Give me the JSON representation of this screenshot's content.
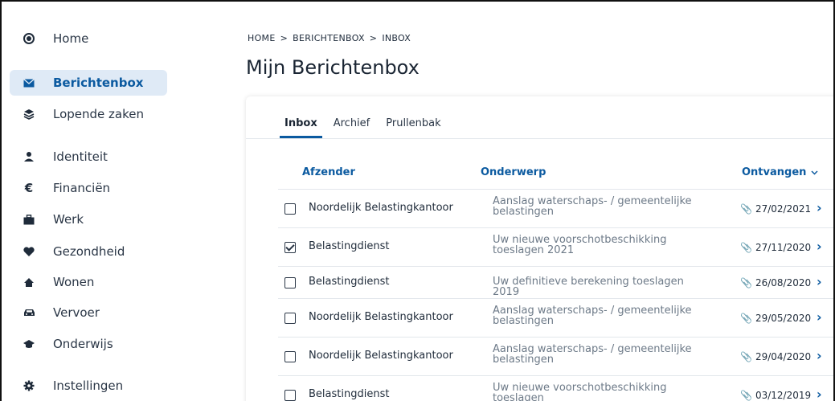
{
  "sidebar": {
    "items": [
      {
        "label": "Home",
        "icon": "home-icon"
      },
      {
        "label": "Berichtenbox",
        "icon": "envelope-icon",
        "active": true
      },
      {
        "label": "Lopende zaken",
        "icon": "layers-icon"
      },
      {
        "label": "Identiteit",
        "icon": "person-icon"
      },
      {
        "label": "Financiën",
        "icon": "euro-icon"
      },
      {
        "label": "Werk",
        "icon": "briefcase-icon"
      },
      {
        "label": "Gezondheid",
        "icon": "heart-icon"
      },
      {
        "label": "Wonen",
        "icon": "house-icon"
      },
      {
        "label": "Vervoer",
        "icon": "car-icon"
      },
      {
        "label": "Onderwijs",
        "icon": "graduation-cap-icon"
      },
      {
        "label": "Instellingen",
        "icon": "gear-icon"
      }
    ]
  },
  "breadcrumb": {
    "items": [
      "HOME",
      "BERICHTENBOX",
      "INBOX"
    ],
    "separator": ">"
  },
  "page": {
    "title": "Mijn Berichtenbox"
  },
  "tabs": [
    {
      "label": "Inbox",
      "active": true
    },
    {
      "label": "Archief"
    },
    {
      "label": "Prullenbak"
    }
  ],
  "table": {
    "columns": {
      "sender": "Afzender",
      "subject": "Onderwerp",
      "date": "Ontvangen"
    },
    "rows": [
      {
        "sender": "Noordelijk Belastingkantoor",
        "subject": "Aanslag waterschaps- / gemeentelijke belastingen",
        "date": "27/02/2021",
        "checked": false
      },
      {
        "sender": "Belastingdienst",
        "subject": "Uw nieuwe voorschotbeschikking toeslagen 2021",
        "date": "27/11/2020",
        "checked": true
      },
      {
        "sender": "Belastingdienst",
        "subject": "Uw definitieve berekening toeslagen 2019",
        "date": "26/08/2020",
        "checked": false
      },
      {
        "sender": "Noordelijk Belastingkantoor",
        "subject": "Aanslag waterschaps- / gemeentelijke belastingen",
        "date": "29/05/2020",
        "checked": false
      },
      {
        "sender": "Noordelijk Belastingkantoor",
        "subject": "Aanslag waterschaps- / gemeentelijke belastingen",
        "date": "29/04/2020",
        "checked": false
      },
      {
        "sender": "Belastingdienst",
        "subject": "Uw nieuwe voorschotbeschikking toeslagen",
        "date": "03/12/2019",
        "checked": false
      }
    ]
  },
  "colors": {
    "accent": "#0b5aa0",
    "active_bg": "#dfeaf6"
  }
}
